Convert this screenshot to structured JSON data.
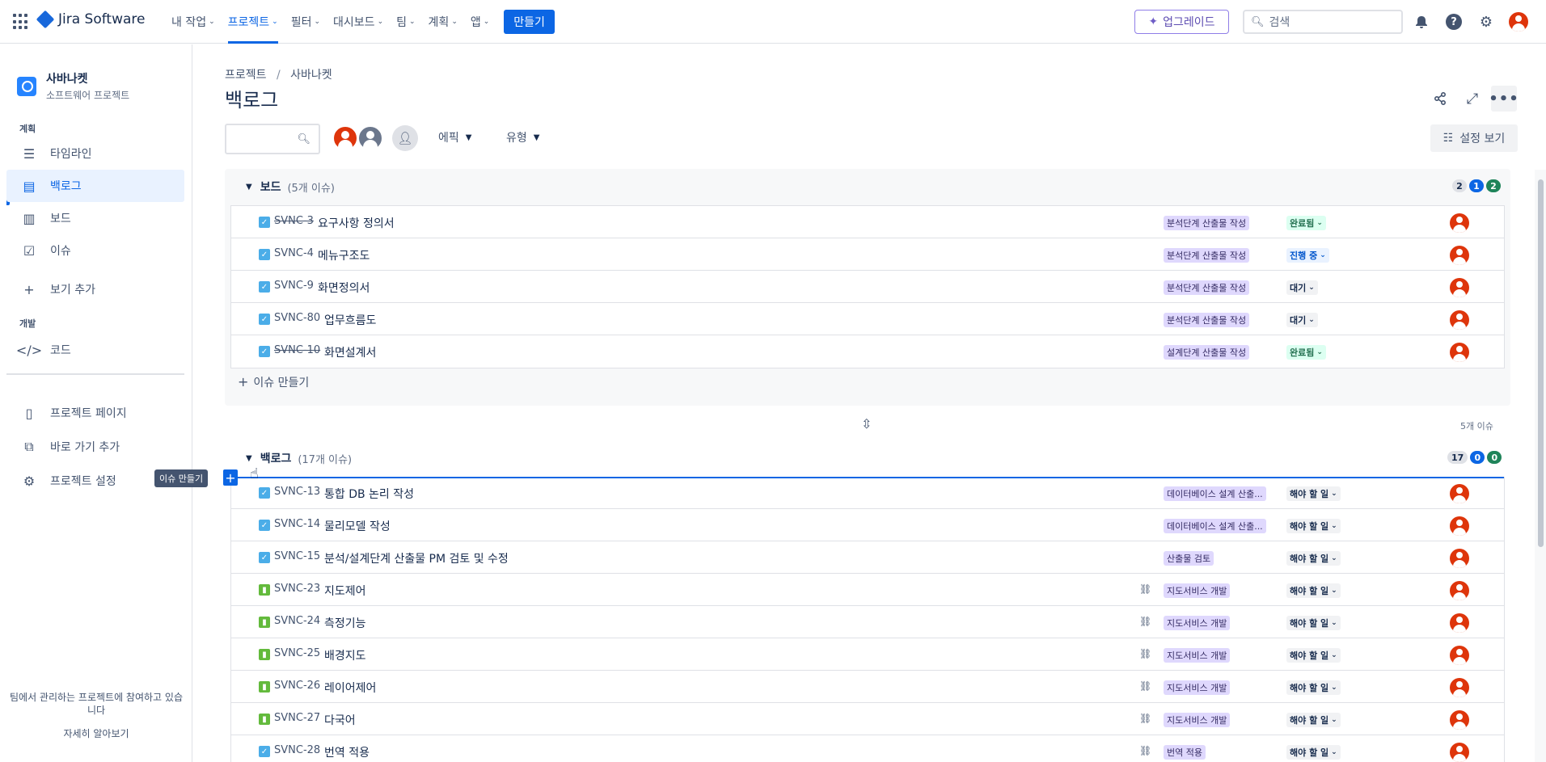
{
  "topnav": {
    "app_name": "Jira Software",
    "items": [
      {
        "label": "내 작업",
        "active": false
      },
      {
        "label": "프로젝트",
        "active": true
      },
      {
        "label": "필터",
        "active": false
      },
      {
        "label": "대시보드",
        "active": false
      },
      {
        "label": "팀",
        "active": false
      },
      {
        "label": "계획",
        "active": false
      },
      {
        "label": "앱",
        "active": false
      }
    ],
    "create_label": "만들기",
    "upgrade_label": "업그레이드",
    "search_placeholder": "검색"
  },
  "sidebar": {
    "project_name": "사바나켓",
    "project_type": "소프트웨어 프로젝트",
    "plan_section": "계획",
    "plan_items": [
      {
        "label": "타임라인",
        "icon": "timeline-icon"
      },
      {
        "label": "백로그",
        "icon": "backlog-icon",
        "active": true
      },
      {
        "label": "보드",
        "icon": "board-icon"
      },
      {
        "label": "이슈",
        "icon": "issues-icon"
      },
      {
        "label": "보기 추가",
        "icon": "plus-icon"
      }
    ],
    "dev_section": "개발",
    "dev_items": [
      {
        "label": "코드",
        "icon": "code-icon"
      }
    ],
    "bottom_items": [
      {
        "label": "프로젝트 페이지",
        "icon": "page-icon"
      },
      {
        "label": "바로 가기 추가",
        "icon": "add-shortcut-icon"
      },
      {
        "label": "프로젝트 설정",
        "icon": "gear-icon"
      }
    ],
    "footer_text": "팀에서 관리하는 프로젝트에 참여하고 있습니다",
    "footer_link": "자세히 알아보기"
  },
  "tooltip": "이슈 만들기",
  "header": {
    "breadcrumb": [
      "프로젝트",
      "사바나켓"
    ],
    "title": "백로그",
    "epic_filter": "에픽",
    "type_filter": "유형",
    "view_settings": "설정 보기"
  },
  "board_section": {
    "name": "보드",
    "count": "(5개 이슈)",
    "badges": [
      "2",
      "1",
      "2"
    ],
    "issues": [
      {
        "key": "SVNC-3",
        "summary": "요구사항 정의서",
        "epic": "분석단계 산출물 작성",
        "status": "완료됨",
        "status_type": "done",
        "type": "task",
        "done": true
      },
      {
        "key": "SVNC-4",
        "summary": "메뉴구조도",
        "epic": "분석단계 산출물 작성",
        "status": "진행 중",
        "status_type": "inprog",
        "type": "task",
        "done": false
      },
      {
        "key": "SVNC-9",
        "summary": "화면정의서",
        "epic": "분석단계 산출물 작성",
        "status": "대기",
        "status_type": "wait",
        "type": "task",
        "done": false
      },
      {
        "key": "SVNC-80",
        "summary": "업무흐름도",
        "epic": "분석단계 산출물 작성",
        "status": "대기",
        "status_type": "wait",
        "type": "task",
        "done": false
      },
      {
        "key": "SVNC-10",
        "summary": "화면설계서",
        "epic": "설계단계 산출물 작성",
        "status": "완료됨",
        "status_type": "done",
        "type": "task",
        "done": true
      }
    ],
    "create_issue": "이슈 만들기",
    "issue_count_text": "5개 이슈"
  },
  "backlog_section": {
    "name": "백로그",
    "count": "(17개 이슈)",
    "badges": [
      "17",
      "0",
      "0"
    ],
    "issues": [
      {
        "key": "SVNC-13",
        "summary": "통합 DB 논리 작성",
        "epic": "데이터베이스 설계 산출...",
        "status": "해야 할 일",
        "type": "task",
        "child": false
      },
      {
        "key": "SVNC-14",
        "summary": "물리모델 작성",
        "epic": "데이터베이스 설계 산출...",
        "status": "해야 할 일",
        "type": "task",
        "child": false
      },
      {
        "key": "SVNC-15",
        "summary": "분석/설계단계 산출물 PM 검토 및 수정",
        "epic": "산출물 검토",
        "status": "해야 할 일",
        "type": "task",
        "child": false
      },
      {
        "key": "SVNC-23",
        "summary": "지도제어",
        "epic": "지도서비스 개발",
        "status": "해야 할 일",
        "type": "story",
        "child": true
      },
      {
        "key": "SVNC-24",
        "summary": "측정기능",
        "epic": "지도서비스 개발",
        "status": "해야 할 일",
        "type": "story",
        "child": true
      },
      {
        "key": "SVNC-25",
        "summary": "배경지도",
        "epic": "지도서비스 개발",
        "status": "해야 할 일",
        "type": "story",
        "child": true
      },
      {
        "key": "SVNC-26",
        "summary": "레이어제어",
        "epic": "지도서비스 개발",
        "status": "해야 할 일",
        "type": "story",
        "child": true
      },
      {
        "key": "SVNC-27",
        "summary": "다국어",
        "epic": "지도서비스 개발",
        "status": "해야 할 일",
        "type": "story",
        "child": true
      },
      {
        "key": "SVNC-28",
        "summary": "번역 적용",
        "epic": "번역 적용",
        "status": "해야 할 일",
        "type": "task",
        "child": true
      }
    ]
  }
}
